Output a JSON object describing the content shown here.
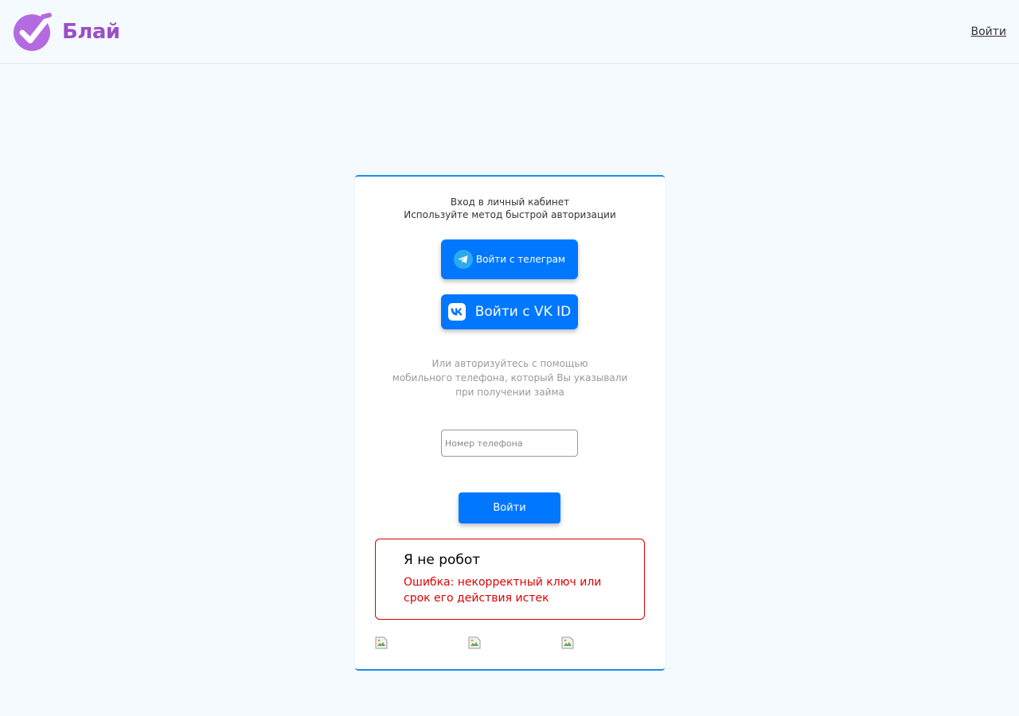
{
  "header": {
    "brand": "Блай",
    "login_link": "Войти",
    "logo_color": "#9b4fc6"
  },
  "card": {
    "title_line1": "Вход в личный кабинет",
    "title_line2": "Используйте метод быстрой авторизации",
    "telegram_button": "Войти с телеграм",
    "vk_button": "Войти с VK ID",
    "alt_line1": "Или авторизуйтесь с помощью",
    "alt_line2": "мобильного телефона, который Вы указывали",
    "alt_line3": "при получении займа",
    "phone_placeholder": "Номер телефона",
    "submit_button": "Войти",
    "accent_color": "#0077ff"
  },
  "captcha": {
    "title": "Я не робот",
    "error": "Ошибка: некорректный ключ или срок его действия истек",
    "error_color": "#e00000"
  },
  "icons": [
    "check-logo-icon",
    "telegram-icon",
    "vk-icon",
    "broken-image-icon"
  ]
}
